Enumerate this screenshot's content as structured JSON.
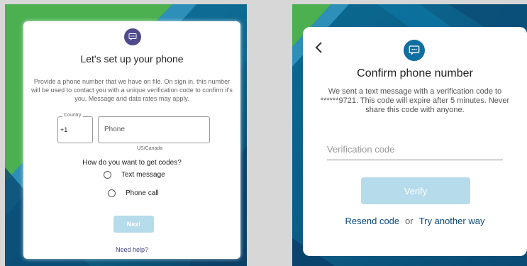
{
  "setup": {
    "title": "Let's set up your phone",
    "description": "Provide a phone number that we have on file. On sign in, this number will be used to contact you with a unique verification code to confirm it's you. Message and data rates may apply.",
    "country_label": "Country",
    "country_value": "+1",
    "phone_placeholder": "Phone",
    "region_hint": "US/Canada",
    "question": "How do you want to get codes?",
    "options": [
      {
        "label": "Text message",
        "selected": false
      },
      {
        "label": "Phone call",
        "selected": false
      }
    ],
    "next_label": "Next",
    "help_label": "Need help?",
    "icon": "chat-message-icon",
    "accent_color": "#4f4a8c"
  },
  "confirm": {
    "title": "Confirm phone number",
    "description": "We sent a text message with a verification code to ******9721. This code will expire after 5 minutes. Never share this code with anyone.",
    "code_placeholder": "Verification code",
    "verify_label": "Verify",
    "resend_label": "Resend code",
    "or_label": "or",
    "try_another_label": "Try another way",
    "icon": "chat-message-icon",
    "back_icon": "chevron-left-icon",
    "accent_color": "#0e6fa0",
    "button_color": "#b6dbea"
  },
  "background": {
    "green": "#4caf50",
    "blue": "#0b5d86"
  }
}
